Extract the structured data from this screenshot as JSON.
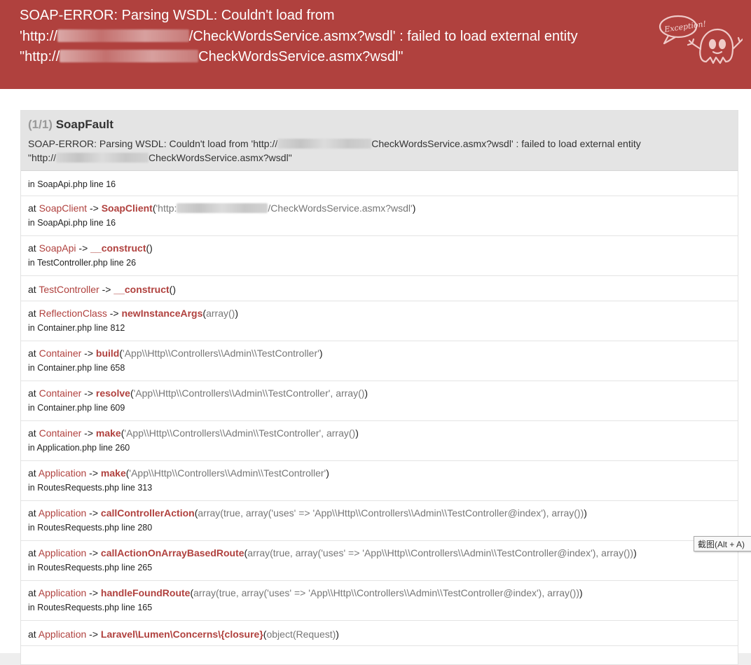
{
  "header": {
    "line1": "SOAP-ERROR: Parsing WSDL: Couldn't load from",
    "line2_prefix": "'http://",
    "line2_suffix": "/CheckWordsService.asmx?wsdl' : failed to load external entity",
    "line3_prefix": "\"http://",
    "line3_suffix": "CheckWordsService.asmx?wsdl\"",
    "badge_text": "Exception!"
  },
  "exception": {
    "count": "(1/1)",
    "type": "SoapFault",
    "message_line1_prefix": "SOAP-ERROR: Parsing WSDL: Couldn't load from 'http://",
    "message_line1_suffix": "CheckWordsService.asmx?wsdl' : failed to load external entity",
    "message_line2_prefix": "\"http://",
    "message_line2_suffix": "CheckWordsService.asmx?wsdl\""
  },
  "trace": {
    "first_location": "in SoapApi.php line 16",
    "frames": [
      {
        "cls": "SoapClient",
        "fn": "SoapClient",
        "args_prefix": "'http:",
        "args_suffix": "/CheckWordsService.asmx?wsdl'",
        "loc": "in SoapApi.php line 16"
      },
      {
        "cls": "SoapApi",
        "fn": "__construct",
        "args": "",
        "loc": "in TestController.php line 26"
      },
      {
        "cls": "TestController",
        "fn": "__construct",
        "args": "",
        "loc": ""
      },
      {
        "cls": "ReflectionClass",
        "fn": "newInstanceArgs",
        "args": "array()",
        "loc": "in Container.php line 812"
      },
      {
        "cls": "Container",
        "fn": "build",
        "args": "'App\\\\Http\\\\Controllers\\\\Admin\\\\TestController'",
        "loc": "in Container.php line 658"
      },
      {
        "cls": "Container",
        "fn": "resolve",
        "args": "'App\\\\Http\\\\Controllers\\\\Admin\\\\TestController', array()",
        "loc": "in Container.php line 609"
      },
      {
        "cls": "Container",
        "fn": "make",
        "args": "'App\\\\Http\\\\Controllers\\\\Admin\\\\TestController', array()",
        "loc": "in Application.php line 260"
      },
      {
        "cls": "Application",
        "fn": "make",
        "args": "'App\\\\Http\\\\Controllers\\\\Admin\\\\TestController'",
        "loc": "in RoutesRequests.php line 313"
      },
      {
        "cls": "Application",
        "fn": "callControllerAction",
        "args": "array(true, array('uses' => 'App\\\\Http\\\\Controllers\\\\Admin\\\\TestController@index'), array())",
        "loc": "in RoutesRequests.php line 280"
      },
      {
        "cls": "Application",
        "fn": "callActionOnArrayBasedRoute",
        "args": "array(true, array('uses' => 'App\\\\Http\\\\Controllers\\\\Admin\\\\TestController@index'), array())",
        "loc": "in RoutesRequests.php line 265"
      },
      {
        "cls": "Application",
        "fn": "handleFoundRoute",
        "args": "array(true, array('uses' => 'App\\\\Http\\\\Controllers\\\\Admin\\\\TestController@index'), array())",
        "loc": "in RoutesRequests.php line 165"
      },
      {
        "cls": "Application",
        "fn": "Laravel\\Lumen\\Concerns\\{closure}",
        "args": "object(Request)",
        "loc": ""
      }
    ]
  },
  "tooltip": "截图(Alt + A)"
}
